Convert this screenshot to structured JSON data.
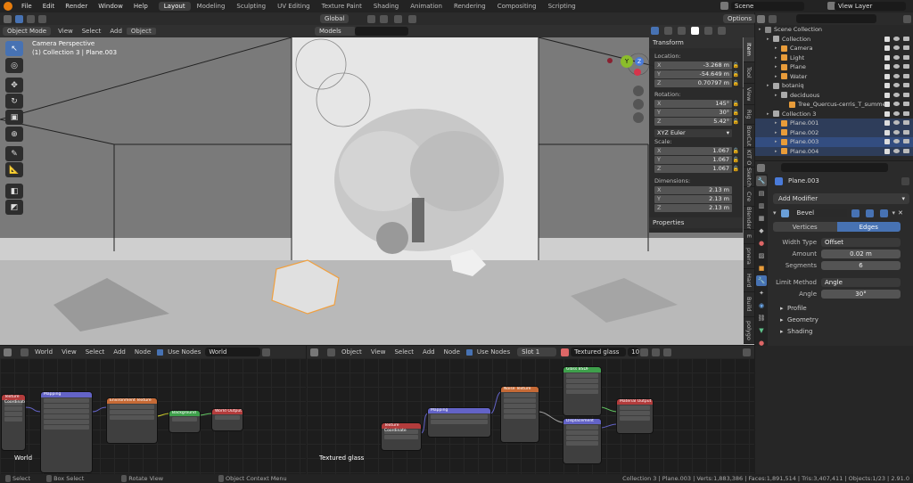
{
  "topbar": {
    "menus": [
      "File",
      "Edit",
      "Render",
      "Window",
      "Help"
    ],
    "workspaces": [
      "Layout",
      "Modeling",
      "Sculpting",
      "UV Editing",
      "Texture Paint",
      "Shading",
      "Animation",
      "Rendering",
      "Compositing",
      "Scripting"
    ],
    "active_workspace": "Layout",
    "scene": "Scene",
    "view_layer": "View Layer"
  },
  "viewport": {
    "mode": "Object Mode",
    "menus": [
      "View",
      "Select",
      "Add",
      "Object"
    ],
    "orientation": "Global",
    "options_label": "Options",
    "models_label": "Models",
    "camera_perspective": "Camera Perspective",
    "collection_info": "(1) Collection 3 | Plane.003",
    "gizmo": {
      "x": "X",
      "y": "Y",
      "z": "Z"
    }
  },
  "npanel": {
    "transform_title": "Transform",
    "location_label": "Location:",
    "location": [
      {
        "axis": "X",
        "value": "-3.268 m"
      },
      {
        "axis": "Y",
        "value": "-54.649 m"
      },
      {
        "axis": "Z",
        "value": "0.70797 m"
      }
    ],
    "rotation_label": "Rotation:",
    "rotation": [
      {
        "axis": "X",
        "value": "145°"
      },
      {
        "axis": "Y",
        "value": "30°"
      },
      {
        "axis": "Z",
        "value": "5.42°"
      }
    ],
    "rotation_mode": "XYZ Euler",
    "scale_label": "Scale:",
    "scale": [
      {
        "axis": "X",
        "value": "1.067"
      },
      {
        "axis": "Y",
        "value": "1.067"
      },
      {
        "axis": "Z",
        "value": "1.067"
      }
    ],
    "dimensions_label": "Dimensions:",
    "dimensions": [
      {
        "axis": "X",
        "value": "2.13 m"
      },
      {
        "axis": "Y",
        "value": "2.13 m"
      },
      {
        "axis": "Z",
        "value": "2.13 m"
      }
    ],
    "properties_title": "Properties"
  },
  "side_tabs": [
    "Tool",
    "View",
    "Rig",
    "BoxCut",
    "KIT O",
    "Sketch",
    "Cre",
    "Blender",
    "E",
    "pnera",
    "Hard",
    "Build",
    "polygo"
  ],
  "outliner": {
    "rows": [
      {
        "label": "Scene Collection",
        "indent": 0,
        "color": "#888"
      },
      {
        "label": "Collection",
        "indent": 1,
        "color": "#aaa"
      },
      {
        "label": "Camera",
        "indent": 2,
        "color": "#e89c3a"
      },
      {
        "label": "Light",
        "indent": 2,
        "color": "#e89c3a"
      },
      {
        "label": "Plane",
        "indent": 2,
        "color": "#e89c3a"
      },
      {
        "label": "Water",
        "indent": 2,
        "color": "#e89c3a"
      },
      {
        "label": "botaniq",
        "indent": 1,
        "color": "#aaa"
      },
      {
        "label": "deciduous",
        "indent": 2,
        "color": "#aaa"
      },
      {
        "label": "Tree_Quercus-cerris_T_summer",
        "indent": 3,
        "color": "#e89c3a"
      },
      {
        "label": "Collection 3",
        "indent": 1,
        "color": "#aaa"
      },
      {
        "label": "Plane.001",
        "indent": 2,
        "color": "#e89c3a"
      },
      {
        "label": "Plane.002",
        "indent": 2,
        "color": "#e89c3a"
      },
      {
        "label": "Plane.003",
        "indent": 2,
        "color": "#e89c3a"
      },
      {
        "label": "Plane.004",
        "indent": 2,
        "color": "#e89c3a"
      }
    ],
    "selected": "Plane.003"
  },
  "properties": {
    "object_name": "Plane.003",
    "add_modifier": "Add Modifier",
    "modifier_name": "Bevel",
    "tabs": [
      "Vertices",
      "Edges"
    ],
    "active_tab": "Edges",
    "width_type_label": "Width Type",
    "width_type": "Offset",
    "amount_label": "Amount",
    "amount": "0.02 m",
    "segments_label": "Segments",
    "segments": "6",
    "limit_method_label": "Limit Method",
    "limit_method": "Angle",
    "angle_label": "Angle",
    "angle": "30°",
    "subpanels": [
      "Profile",
      "Geometry",
      "Shading"
    ]
  },
  "node_left": {
    "type": "World",
    "menus": [
      "View",
      "Select",
      "Add",
      "Node"
    ],
    "use_nodes": "Use Nodes",
    "datablock": "World",
    "label": "World"
  },
  "node_right": {
    "type": "Object",
    "menus": [
      "View",
      "Select",
      "Add",
      "Node"
    ],
    "use_nodes": "Use Nodes",
    "slot": "Slot 1",
    "material": "Textured glass",
    "users": "10",
    "label": "Textured glass"
  },
  "status": {
    "select": "Select",
    "box_select": "Box Select",
    "rotate_view": "Rotate View",
    "context_menu": "Object Context Menu",
    "stats": "Collection 3 | Plane.003 | Verts:1,883,386 | Faces:1,891,514 | Tris:3,407,411 | Objects:1/23 | 2.91.0"
  }
}
